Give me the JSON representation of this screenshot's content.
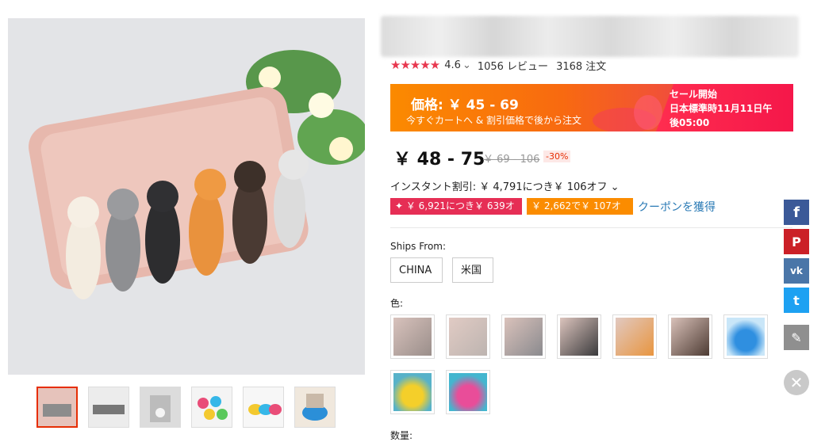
{
  "gallery": {
    "main_image": "cat-phone-stand-photo",
    "thumbnails": [
      "cats-pink-phone",
      "cats-row-grey",
      "cat-white-stand",
      "colored-elephants",
      "elephant-set",
      "blue-elephant-stand"
    ],
    "selected_thumbnail": 0
  },
  "rating": {
    "score": "4.6",
    "chevron": "⌄",
    "reviews": "1056 レビュー",
    "orders": "3168 注文"
  },
  "banner": {
    "price_label": "価格: ￥ 45 - 69",
    "price_sub": "今すぐカートへ & 割引価格で後から注文",
    "sale_line1": "セール開始",
    "sale_line2": "日本標準時11月11日午",
    "sale_line3": "後05:00"
  },
  "price": {
    "current": "￥ 48 - 75",
    "original": "￥ 69 - 106",
    "discount": "-30%"
  },
  "instant_discount": "インスタント割引: ￥ 4,791につき￥ 106オフ ⌄",
  "coupons": {
    "red": "✦ ￥ 6,921につき￥ 639オフ",
    "orange": "￥ 2,662で￥ 107オフ",
    "get_link": "クーポンを獲得"
  },
  "ships_from": {
    "label": "Ships From:",
    "options": [
      "CHINA",
      "米国"
    ]
  },
  "color": {
    "label": "色:"
  },
  "quantity": {
    "label": "数量:"
  },
  "share": {
    "facebook": "f",
    "pinterest": "P",
    "vk": "vk",
    "twitter": "t",
    "edit": "✎",
    "close": "✕"
  },
  "colors": {
    "accent": "#e62e04",
    "star": "#e8384f",
    "link": "#2a7ab5"
  }
}
